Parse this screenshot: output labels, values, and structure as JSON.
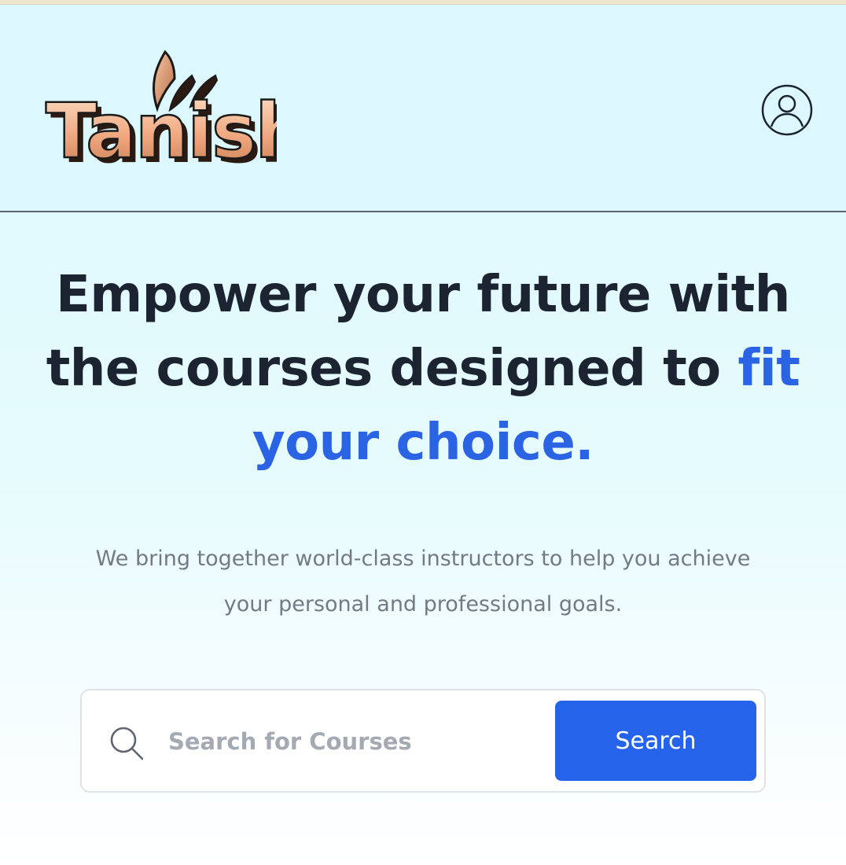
{
  "brand": {
    "logo_text": "Tanish"
  },
  "header": {
    "profile_icon": "user-circle-icon"
  },
  "hero": {
    "headline_part1": "Empower your future with the courses designed to ",
    "headline_accent": "fit your choice.",
    "subtitle": "We bring together world-class instructors to help you achieve your personal and professional goals."
  },
  "search": {
    "icon": "search-icon",
    "placeholder": "Search for Courses",
    "button_label": "Search"
  },
  "colors": {
    "accent": "#2b63e5",
    "button": "#2563eb",
    "header_background": "#dcf8fd",
    "headline_text": "#1c2432",
    "logo_gradient_start": "#fbd4b8",
    "logo_gradient_end": "#c77b4e"
  }
}
